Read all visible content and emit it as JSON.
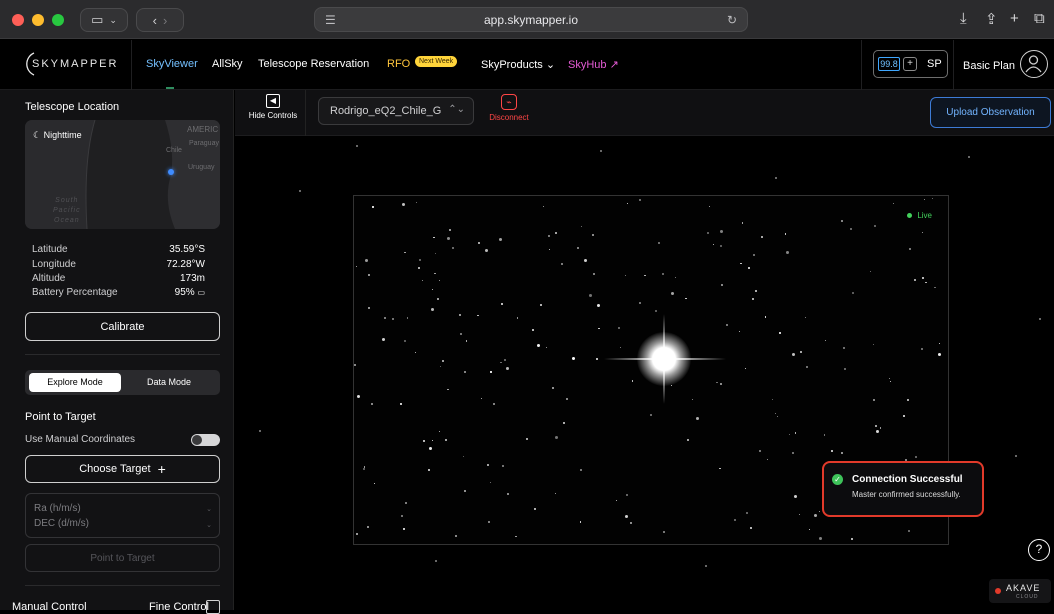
{
  "browser": {
    "url": "app.skymapper.io"
  },
  "nav": {
    "logo_text": "SKYMAPPER",
    "links": [
      {
        "label": "SkyViewer"
      },
      {
        "label": "AllSky"
      },
      {
        "label": "Telescope Reservation"
      },
      {
        "label": "RFO"
      },
      {
        "label": "SkyProducts"
      },
      {
        "label": "SkyHub"
      }
    ],
    "rfo_badge": "Next Week",
    "skyproducts_caret": "⌄",
    "skyhub_arrow": "↗",
    "sp_value": "99.8",
    "sp_label": "SP",
    "plan": "Basic Plan"
  },
  "sidebar": {
    "section_title": "Telescope Location",
    "map": {
      "mode": "Nighttime",
      "labels": [
        "AMERIC",
        "Paraguay",
        "Chile",
        "Uruguay"
      ],
      "ocean_lines": [
        "South",
        "Pacific",
        "Ocean"
      ]
    },
    "location": [
      {
        "label": "Latitude",
        "value": "35.59°S"
      },
      {
        "label": "Longitude",
        "value": "72.28°W"
      },
      {
        "label": "Altitude",
        "value": "173m"
      },
      {
        "label": "Battery Percentage",
        "value": "95%"
      }
    ],
    "calibrate_label": "Calibrate",
    "modes": {
      "explore": "Explore Mode",
      "data": "Data Mode",
      "selected": "Explore Mode"
    },
    "point_title": "Point to Target",
    "manual_coords_label": "Use Manual Coordinates",
    "manual_coords_on": false,
    "choose_target_label": "Choose Target",
    "ra_placeholder": "Ra (h/m/s)",
    "dec_placeholder": "DEC (d/m/s)",
    "point_button_label": "Point to Target",
    "manual_control_label": "Manual Control",
    "fine_control_label": "Fine Control"
  },
  "main": {
    "hide_controls_label": "Hide Controls",
    "telescope_select_value": "Rodrigo_eQ2_Chile_G",
    "disconnect_label": "Disconnect",
    "upload_label": "Upload Observation",
    "live_label": "Live",
    "toast": {
      "title": "Connection Successful",
      "message": "Master confirmed successfully."
    },
    "help_label": "?",
    "akave_label": "AKAVE",
    "akave_sub": "CLOUD"
  },
  "colors": {
    "accent_blue": "#74c0ff",
    "rfo_yellow": "#ffc63d",
    "skyhub_pink": "#e45bd5",
    "live_green": "#43d15c",
    "danger_red": "#e23a2a"
  }
}
